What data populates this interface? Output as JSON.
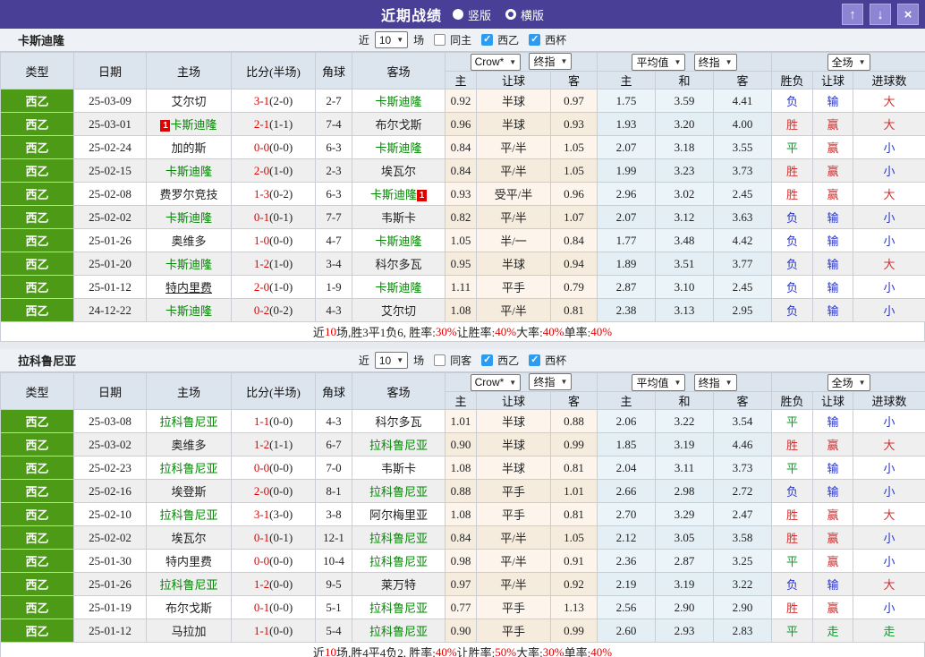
{
  "titlebar": {
    "title": "近期战绩",
    "radio_vertical": "竖版",
    "radio_horizontal": "横版",
    "selected_layout": "竖版",
    "up_icon": "↑",
    "down_icon": "↓",
    "close_icon": "×"
  },
  "colors": {
    "titlebar_bg": "#4a3f96",
    "type_green": "#4d9a16",
    "team_green": "#008800",
    "score_red": "#e00000",
    "result_red": "#d43030",
    "result_blue": "#2a35c8",
    "result_green": "#089a2a",
    "checkbox_blue": "#2d9bf0"
  },
  "table_header": {
    "cols": [
      "类型",
      "日期",
      "主场",
      "比分(半场)",
      "角球",
      "客场"
    ],
    "crow_select": "Crow*",
    "crow_final_select": "终指",
    "group1_cols": [
      "主",
      "让球",
      "客"
    ],
    "avg_select": "平均值",
    "avg_final_select": "终指",
    "group2_cols": [
      "主",
      "和",
      "客"
    ],
    "full_select": "全场",
    "group3_cols": [
      "胜负",
      "让球",
      "进球数"
    ]
  },
  "sections": [
    {
      "team": "卡斯迪隆",
      "filter": {
        "near_label": "近",
        "count": "10",
        "games_label": "场",
        "same_label": "同主",
        "same_checked": false,
        "league_label": "西乙",
        "league_checked": true,
        "cup_label": "西杯",
        "cup_checked": true
      },
      "rows": [
        {
          "league": "西乙",
          "date": "25-03-09",
          "home": {
            "name": "艾尔切"
          },
          "ft": "3-1",
          "ht": "(2-0)",
          "corner": "2-7",
          "away": {
            "name": "卡斯迪隆",
            "self": true
          },
          "crow": [
            "0.92",
            "半球",
            "0.97"
          ],
          "avg": [
            "1.75",
            "3.59",
            "4.41"
          ],
          "results": [
            [
              "负",
              "b"
            ],
            [
              "输",
              "b"
            ],
            [
              "大",
              "r"
            ]
          ]
        },
        {
          "league": "西乙",
          "date": "25-03-01",
          "home": {
            "name": "卡斯迪隆",
            "self": true,
            "card": "1"
          },
          "ft": "2-1",
          "ht": "(1-1)",
          "corner": "7-4",
          "away": {
            "name": "布尔戈斯"
          },
          "crow": [
            "0.96",
            "半球",
            "0.93"
          ],
          "avg": [
            "1.93",
            "3.20",
            "4.00"
          ],
          "results": [
            [
              "胜",
              "r"
            ],
            [
              "赢",
              "r"
            ],
            [
              "大",
              "r"
            ]
          ]
        },
        {
          "league": "西乙",
          "date": "25-02-24",
          "home": {
            "name": "加的斯"
          },
          "ft": "0-0",
          "ht": "(0-0)",
          "corner": "6-3",
          "away": {
            "name": "卡斯迪隆",
            "self": true
          },
          "crow": [
            "0.84",
            "平/半",
            "1.05"
          ],
          "avg": [
            "2.07",
            "3.18",
            "3.55"
          ],
          "results": [
            [
              "平",
              "g"
            ],
            [
              "赢",
              "r"
            ],
            [
              "小",
              "b"
            ]
          ]
        },
        {
          "league": "西乙",
          "date": "25-02-15",
          "home": {
            "name": "卡斯迪隆",
            "self": true
          },
          "ft": "2-0",
          "ht": "(1-0)",
          "corner": "2-3",
          "away": {
            "name": "埃瓦尔"
          },
          "crow": [
            "0.84",
            "平/半",
            "1.05"
          ],
          "avg": [
            "1.99",
            "3.23",
            "3.73"
          ],
          "results": [
            [
              "胜",
              "r"
            ],
            [
              "赢",
              "r"
            ],
            [
              "小",
              "b"
            ]
          ]
        },
        {
          "league": "西乙",
          "date": "25-02-08",
          "home": {
            "name": "费罗尔竞技"
          },
          "ft": "1-3",
          "ht": "(0-2)",
          "corner": "6-3",
          "away": {
            "name": "卡斯迪隆",
            "self": true,
            "card": "1"
          },
          "crow": [
            "0.93",
            "受平/半",
            "0.96"
          ],
          "avg": [
            "2.96",
            "3.02",
            "2.45"
          ],
          "results": [
            [
              "胜",
              "r"
            ],
            [
              "赢",
              "r"
            ],
            [
              "大",
              "r"
            ]
          ]
        },
        {
          "league": "西乙",
          "date": "25-02-02",
          "home": {
            "name": "卡斯迪隆",
            "self": true
          },
          "ft": "0-1",
          "ht": "(0-1)",
          "corner": "7-7",
          "away": {
            "name": "韦斯卡"
          },
          "crow": [
            "0.82",
            "平/半",
            "1.07"
          ],
          "avg": [
            "2.07",
            "3.12",
            "3.63"
          ],
          "results": [
            [
              "负",
              "b"
            ],
            [
              "输",
              "b"
            ],
            [
              "小",
              "b"
            ]
          ]
        },
        {
          "league": "西乙",
          "date": "25-01-26",
          "home": {
            "name": "奥维多"
          },
          "ft": "1-0",
          "ht": "(0-0)",
          "corner": "4-7",
          "away": {
            "name": "卡斯迪隆",
            "self": true
          },
          "crow": [
            "1.05",
            "半/一",
            "0.84"
          ],
          "avg": [
            "1.77",
            "3.48",
            "4.42"
          ],
          "results": [
            [
              "负",
              "b"
            ],
            [
              "输",
              "b"
            ],
            [
              "小",
              "b"
            ]
          ]
        },
        {
          "league": "西乙",
          "date": "25-01-20",
          "home": {
            "name": "卡斯迪隆",
            "self": true
          },
          "ft": "1-2",
          "ht": "(1-0)",
          "corner": "3-4",
          "away": {
            "name": "科尔多瓦"
          },
          "crow": [
            "0.95",
            "半球",
            "0.94"
          ],
          "avg": [
            "1.89",
            "3.51",
            "3.77"
          ],
          "results": [
            [
              "负",
              "b"
            ],
            [
              "输",
              "b"
            ],
            [
              "大",
              "r"
            ]
          ]
        },
        {
          "league": "西乙",
          "date": "25-01-12",
          "home": {
            "name": "特内里费",
            "underline": true
          },
          "ft": "2-0",
          "ht": "(1-0)",
          "corner": "1-9",
          "away": {
            "name": "卡斯迪隆",
            "self": true
          },
          "crow": [
            "1.11",
            "平手",
            "0.79"
          ],
          "avg": [
            "2.87",
            "3.10",
            "2.45"
          ],
          "results": [
            [
              "负",
              "b"
            ],
            [
              "输",
              "b"
            ],
            [
              "小",
              "b"
            ]
          ]
        },
        {
          "league": "西乙",
          "date": "24-12-22",
          "home": {
            "name": "卡斯迪隆",
            "self": true
          },
          "ft": "0-2",
          "ht": "(0-2)",
          "corner": "4-3",
          "away": {
            "name": "艾尔切"
          },
          "crow": [
            "1.08",
            "平/半",
            "0.81"
          ],
          "avg": [
            "2.38",
            "3.13",
            "2.95"
          ],
          "results": [
            [
              "负",
              "b"
            ],
            [
              "输",
              "b"
            ],
            [
              "小",
              "b"
            ]
          ]
        }
      ],
      "footer": [
        [
          "近",
          "k"
        ],
        [
          "10",
          "r"
        ],
        [
          "场,胜3平1负6, 胜率:",
          "k"
        ],
        [
          "30%",
          "r"
        ],
        [
          " 让胜率:",
          "k"
        ],
        [
          "40%",
          "r"
        ],
        [
          " 大率:",
          "k"
        ],
        [
          "40%",
          "r"
        ],
        [
          " 单率:",
          "k"
        ],
        [
          "40%",
          "r"
        ]
      ]
    },
    {
      "team": "拉科鲁尼亚",
      "filter": {
        "near_label": "近",
        "count": "10",
        "games_label": "场",
        "same_label": "同客",
        "same_checked": false,
        "league_label": "西乙",
        "league_checked": true,
        "cup_label": "西杯",
        "cup_checked": true
      },
      "rows": [
        {
          "league": "西乙",
          "date": "25-03-08",
          "home": {
            "name": "拉科鲁尼亚",
            "self": true
          },
          "ft": "1-1",
          "ht": "(0-0)",
          "corner": "4-3",
          "away": {
            "name": "科尔多瓦"
          },
          "crow": [
            "1.01",
            "半球",
            "0.88"
          ],
          "avg": [
            "2.06",
            "3.22",
            "3.54"
          ],
          "results": [
            [
              "平",
              "g"
            ],
            [
              "输",
              "b"
            ],
            [
              "小",
              "b"
            ]
          ]
        },
        {
          "league": "西乙",
          "date": "25-03-02",
          "home": {
            "name": "奥维多"
          },
          "ft": "1-2",
          "ht": "(1-1)",
          "corner": "6-7",
          "away": {
            "name": "拉科鲁尼亚",
            "self": true
          },
          "crow": [
            "0.90",
            "半球",
            "0.99"
          ],
          "avg": [
            "1.85",
            "3.19",
            "4.46"
          ],
          "results": [
            [
              "胜",
              "r"
            ],
            [
              "赢",
              "r"
            ],
            [
              "大",
              "r"
            ]
          ]
        },
        {
          "league": "西乙",
          "date": "25-02-23",
          "home": {
            "name": "拉科鲁尼亚",
            "self": true
          },
          "ft": "0-0",
          "ht": "(0-0)",
          "corner": "7-0",
          "away": {
            "name": "韦斯卡"
          },
          "crow": [
            "1.08",
            "半球",
            "0.81"
          ],
          "avg": [
            "2.04",
            "3.11",
            "3.73"
          ],
          "results": [
            [
              "平",
              "g"
            ],
            [
              "输",
              "b"
            ],
            [
              "小",
              "b"
            ]
          ]
        },
        {
          "league": "西乙",
          "date": "25-02-16",
          "home": {
            "name": "埃登斯"
          },
          "ft": "2-0",
          "ht": "(0-0)",
          "corner": "8-1",
          "away": {
            "name": "拉科鲁尼亚",
            "self": true
          },
          "crow": [
            "0.88",
            "平手",
            "1.01"
          ],
          "avg": [
            "2.66",
            "2.98",
            "2.72"
          ],
          "results": [
            [
              "负",
              "b"
            ],
            [
              "输",
              "b"
            ],
            [
              "小",
              "b"
            ]
          ]
        },
        {
          "league": "西乙",
          "date": "25-02-10",
          "home": {
            "name": "拉科鲁尼亚",
            "self": true
          },
          "ft": "3-1",
          "ht": "(3-0)",
          "corner": "3-8",
          "away": {
            "name": "阿尔梅里亚"
          },
          "crow": [
            "1.08",
            "平手",
            "0.81"
          ],
          "avg": [
            "2.70",
            "3.29",
            "2.47"
          ],
          "results": [
            [
              "胜",
              "r"
            ],
            [
              "赢",
              "r"
            ],
            [
              "大",
              "r"
            ]
          ]
        },
        {
          "league": "西乙",
          "date": "25-02-02",
          "home": {
            "name": "埃瓦尔"
          },
          "ft": "0-1",
          "ht": "(0-1)",
          "corner": "12-1",
          "away": {
            "name": "拉科鲁尼亚",
            "self": true
          },
          "crow": [
            "0.84",
            "平/半",
            "1.05"
          ],
          "avg": [
            "2.12",
            "3.05",
            "3.58"
          ],
          "results": [
            [
              "胜",
              "r"
            ],
            [
              "赢",
              "r"
            ],
            [
              "小",
              "b"
            ]
          ]
        },
        {
          "league": "西乙",
          "date": "25-01-30",
          "home": {
            "name": "特内里费"
          },
          "ft": "0-0",
          "ht": "(0-0)",
          "corner": "10-4",
          "away": {
            "name": "拉科鲁尼亚",
            "self": true
          },
          "crow": [
            "0.98",
            "平/半",
            "0.91"
          ],
          "avg": [
            "2.36",
            "2.87",
            "3.25"
          ],
          "results": [
            [
              "平",
              "g"
            ],
            [
              "赢",
              "r"
            ],
            [
              "小",
              "b"
            ]
          ]
        },
        {
          "league": "西乙",
          "date": "25-01-26",
          "home": {
            "name": "拉科鲁尼亚",
            "self": true
          },
          "ft": "1-2",
          "ht": "(0-0)",
          "corner": "9-5",
          "away": {
            "name": "莱万特"
          },
          "crow": [
            "0.97",
            "平/半",
            "0.92"
          ],
          "avg": [
            "2.19",
            "3.19",
            "3.22"
          ],
          "results": [
            [
              "负",
              "b"
            ],
            [
              "输",
              "b"
            ],
            [
              "大",
              "r"
            ]
          ]
        },
        {
          "league": "西乙",
          "date": "25-01-19",
          "home": {
            "name": "布尔戈斯"
          },
          "ft": "0-1",
          "ht": "(0-0)",
          "corner": "5-1",
          "away": {
            "name": "拉科鲁尼亚",
            "self": true
          },
          "crow": [
            "0.77",
            "平手",
            "1.13"
          ],
          "avg": [
            "2.56",
            "2.90",
            "2.90"
          ],
          "results": [
            [
              "胜",
              "r"
            ],
            [
              "赢",
              "r"
            ],
            [
              "小",
              "b"
            ]
          ]
        },
        {
          "league": "西乙",
          "date": "25-01-12",
          "home": {
            "name": "马拉加"
          },
          "ft": "1-1",
          "ht": "(0-0)",
          "corner": "5-4",
          "away": {
            "name": "拉科鲁尼亚",
            "self": true
          },
          "crow": [
            "0.90",
            "平手",
            "0.99"
          ],
          "avg": [
            "2.60",
            "2.93",
            "2.83"
          ],
          "results": [
            [
              "平",
              "g"
            ],
            [
              "走",
              "g"
            ],
            [
              "走",
              "g"
            ]
          ]
        }
      ],
      "footer": [
        [
          "近",
          "k"
        ],
        [
          "10",
          "r"
        ],
        [
          "场,胜4平4负2, 胜率:",
          "k"
        ],
        [
          "40%",
          "r"
        ],
        [
          " 让胜率:",
          "k"
        ],
        [
          "50%",
          "r"
        ],
        [
          " 大率:",
          "k"
        ],
        [
          "30%",
          "r"
        ],
        [
          " 单率:",
          "k"
        ],
        [
          "40%",
          "r"
        ]
      ]
    }
  ]
}
